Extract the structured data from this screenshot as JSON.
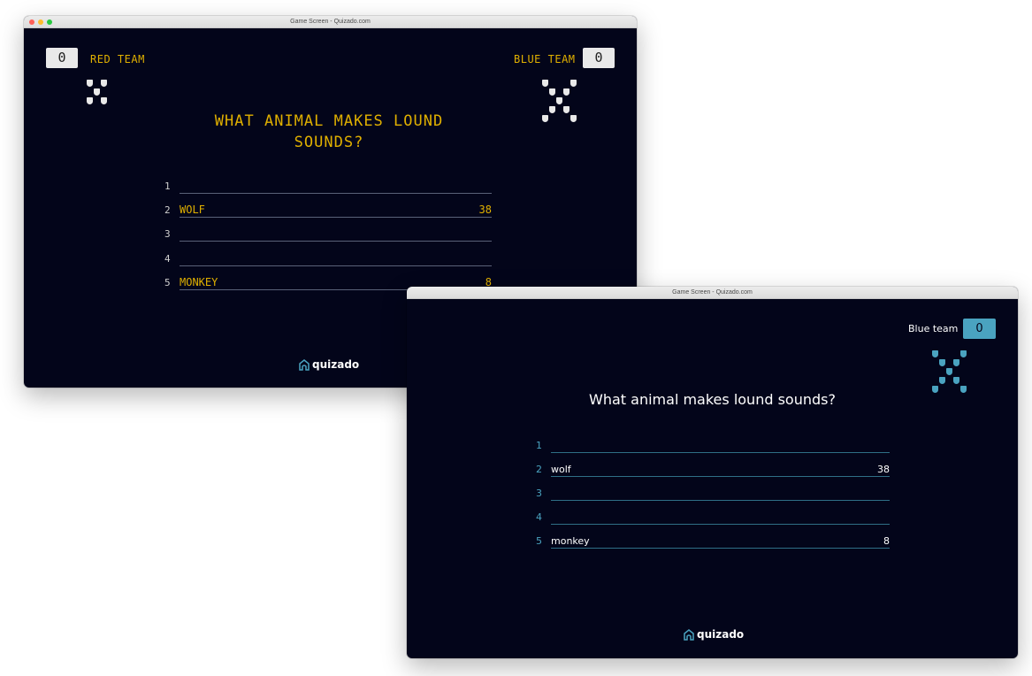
{
  "window1": {
    "title": "Game Screen - Quizado.com",
    "red_team": {
      "label": "RED TEAM",
      "score": "0"
    },
    "blue_team": {
      "label": "BLUE TEAM",
      "score": "0"
    },
    "question": "WHAT ANIMAL MAKES LOUND SOUNDS?",
    "answers": [
      {
        "num": "1",
        "text": "",
        "points": ""
      },
      {
        "num": "2",
        "text": "WOLF",
        "points": "38"
      },
      {
        "num": "3",
        "text": "",
        "points": ""
      },
      {
        "num": "4",
        "text": "",
        "points": ""
      },
      {
        "num": "5",
        "text": "MONKEY",
        "points": "8"
      }
    ],
    "brand": "quizado",
    "colors": {
      "accent": "#e0b000",
      "background": "#03051a",
      "strike": "#e9e9e9"
    }
  },
  "window2": {
    "title": "Game Screen - Quizado.com",
    "blue_team": {
      "label": "Blue team",
      "score": "0"
    },
    "question": "What animal makes lound sounds?",
    "answers": [
      {
        "num": "1",
        "text": "",
        "points": ""
      },
      {
        "num": "2",
        "text": "wolf",
        "points": "38"
      },
      {
        "num": "3",
        "text": "",
        "points": ""
      },
      {
        "num": "4",
        "text": "",
        "points": ""
      },
      {
        "num": "5",
        "text": "monkey",
        "points": "8"
      }
    ],
    "brand": "quizado",
    "colors": {
      "accent": "#4aa3c0",
      "background": "#03051a"
    }
  }
}
